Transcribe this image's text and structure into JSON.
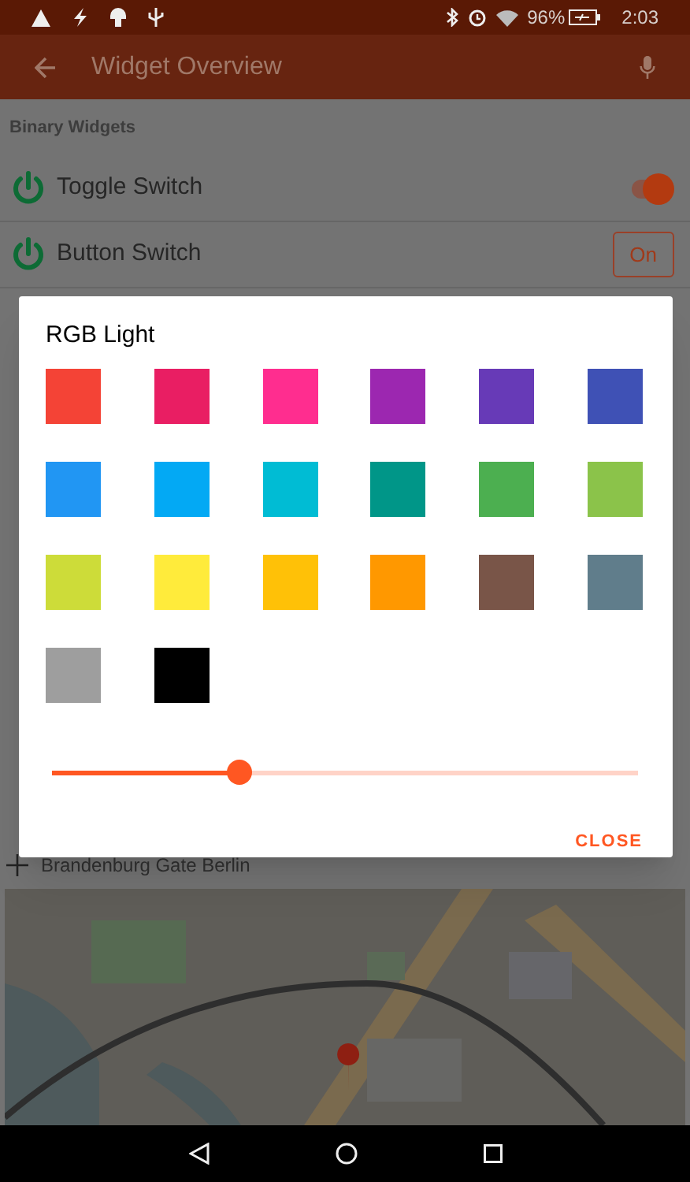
{
  "status_bar": {
    "battery": "96%",
    "time": "2:03"
  },
  "app_bar": {
    "title": "Widget Overview"
  },
  "section": {
    "title": "Binary Widgets"
  },
  "widgets": [
    {
      "kind": "toggle",
      "label": "Toggle Switch",
      "on": true
    },
    {
      "kind": "button",
      "label": "Button Switch",
      "button_label": "On"
    }
  ],
  "location": {
    "label": "Brandenburg Gate Berlin"
  },
  "dialog": {
    "title": "RGB Light",
    "colors": [
      {
        "color": "#f44336"
      },
      {
        "color": "#e91e63"
      },
      {
        "color": "#ff2d8f"
      },
      {
        "color": "#9c27b0"
      },
      {
        "color": "#673ab7"
      },
      {
        "color": "#3f51b5"
      },
      {
        "color": "#2196f3"
      },
      {
        "color": "#03a9f4"
      },
      {
        "color": "#00bcd4"
      },
      {
        "color": "#009688"
      },
      {
        "color": "#4caf50"
      },
      {
        "color": "#8bc34a"
      },
      {
        "color": "#cddc39"
      },
      {
        "color": "#ffeb3b"
      },
      {
        "color": "#ffc107"
      },
      {
        "color": "#ff9800"
      },
      {
        "color": "#795548"
      },
      {
        "color": "#607d8b"
      },
      {
        "color": "#9e9e9e"
      },
      {
        "color": "#000000"
      }
    ],
    "brightness": {
      "level": 0.32
    },
    "close_button": "CLOSE"
  }
}
